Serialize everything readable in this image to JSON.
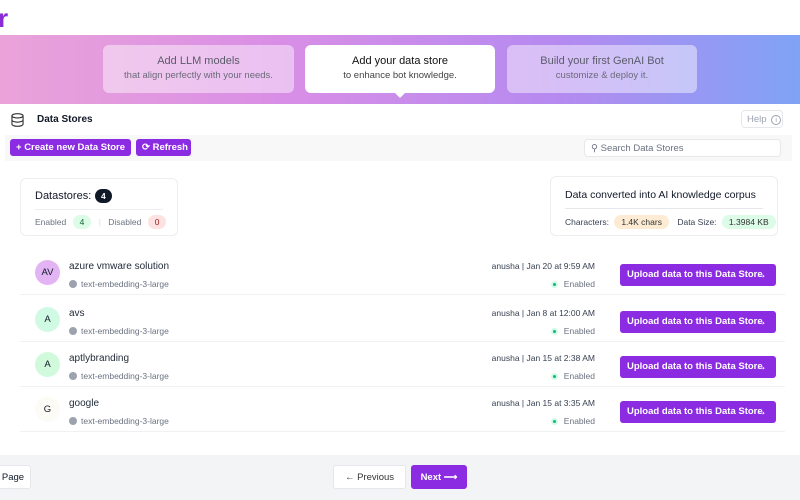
{
  "logo": {
    "partial_text": "r"
  },
  "steps": [
    {
      "title": "Add LLM models",
      "subtitle": "that align perfectly with your needs."
    },
    {
      "title": "Add your data store",
      "subtitle": "to enhance bot knowledge."
    },
    {
      "title": "Build your first GenAI Bot",
      "subtitle": "customize & deploy it."
    }
  ],
  "header": {
    "title": "Data Stores",
    "help_label": "Help"
  },
  "toolbar": {
    "create_label": "Create new Data Store",
    "refresh_label": "Refresh",
    "search_placeholder": "Search Data Stores"
  },
  "stats": {
    "title": "Datastores:",
    "total": "4",
    "enabled_label": "Enabled",
    "enabled": "4",
    "disabled_label": "Disabled",
    "disabled": "0"
  },
  "corpus": {
    "title": "Data converted into AI knowledge corpus",
    "characters_label": "Characters:",
    "characters": "1.4K chars",
    "size_label": "Data Size:",
    "size": "1.3984 KB"
  },
  "rows": [
    {
      "initials": "AV",
      "name": "azure vmware solution",
      "model": "text-embedding-3-large",
      "meta": "anusha | Jan 20 at 9:59 AM",
      "status": "Enabled",
      "action": "Upload data to this Data Store",
      "avatar_bg": "#e3b4f4"
    },
    {
      "initials": "A",
      "name": "avs",
      "model": "text-embedding-3-large",
      "meta": "anusha | Jan 8 at 12:00 AM",
      "status": "Enabled",
      "action": "Upload data to this Data Store",
      "avatar_bg": "#d1fae5"
    },
    {
      "initials": "A",
      "name": "aptlybranding",
      "model": "text-embedding-3-large",
      "meta": "anusha | Jan 15 at 2:38 AM",
      "status": "Enabled",
      "action": "Upload data to this Data Store",
      "avatar_bg": "#d1fadc"
    },
    {
      "initials": "G",
      "name": "google",
      "model": "text-embedding-3-large",
      "meta": "anusha | Jan 15 at 3:35 AM",
      "status": "Enabled",
      "action": "Upload data to this Data Store",
      "avatar_bg": "#fdfbf5"
    }
  ],
  "pagination": {
    "page_label": "Page",
    "prev_label": "← Previous",
    "next_label": "Next ⟶"
  }
}
